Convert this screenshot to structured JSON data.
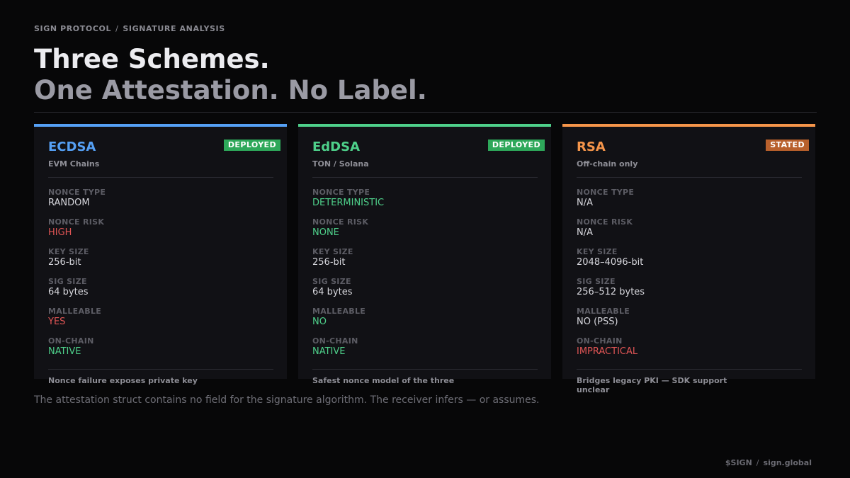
{
  "breadcrumb": {
    "part1": "SIGN PROTOCOL",
    "separator": "/",
    "part2": "SIGNATURE ANALYSIS"
  },
  "title": {
    "line1": "Three Schemes.",
    "line2": "One Attestation. No Label."
  },
  "cards": [
    {
      "name": "ECDSA",
      "badge": "DEPLOYED",
      "subtitle": "EVM Chains",
      "accent": "#55a0f5",
      "badge_color": "#2ea85a",
      "fields": [
        {
          "label": "NONCE TYPE",
          "value": "RANDOM",
          "status": "neutral"
        },
        {
          "label": "NONCE RISK",
          "value": "HIGH",
          "status": "bad"
        },
        {
          "label": "KEY SIZE",
          "value": "256-bit",
          "status": "neutral"
        },
        {
          "label": "SIG SIZE",
          "value": "64 bytes",
          "status": "neutral"
        },
        {
          "label": "MALLEABLE",
          "value": "YES",
          "status": "bad"
        },
        {
          "label": "ON-CHAIN",
          "value": "NATIVE",
          "status": "good"
        }
      ],
      "note": "Nonce failure exposes private key"
    },
    {
      "name": "EdDSA",
      "badge": "DEPLOYED",
      "subtitle": "TON / Solana",
      "accent": "#4ed08a",
      "badge_color": "#2ea85a",
      "fields": [
        {
          "label": "NONCE TYPE",
          "value": "DETERMINISTIC",
          "status": "good"
        },
        {
          "label": "NONCE RISK",
          "value": "NONE",
          "status": "good"
        },
        {
          "label": "KEY SIZE",
          "value": "256-bit",
          "status": "neutral"
        },
        {
          "label": "SIG SIZE",
          "value": "64 bytes",
          "status": "neutral"
        },
        {
          "label": "MALLEABLE",
          "value": "NO",
          "status": "good"
        },
        {
          "label": "ON-CHAIN",
          "value": "NATIVE",
          "status": "good"
        }
      ],
      "note": "Safest nonce model of the three"
    },
    {
      "name": "RSA",
      "badge": "STATED",
      "subtitle": "Off-chain only",
      "accent": "#f5954a",
      "badge_color": "#b8602c",
      "fields": [
        {
          "label": "NONCE TYPE",
          "value": "N/A",
          "status": "neutral"
        },
        {
          "label": "NONCE RISK",
          "value": "N/A",
          "status": "neutral"
        },
        {
          "label": "KEY SIZE",
          "value": "2048–4096-bit",
          "status": "neutral"
        },
        {
          "label": "SIG SIZE",
          "value": "256–512 bytes",
          "status": "neutral"
        },
        {
          "label": "MALLEABLE",
          "value": "NO (PSS)",
          "status": "neutral"
        },
        {
          "label": "ON-CHAIN",
          "value": "IMPRACTICAL",
          "status": "bad"
        }
      ],
      "note": "Bridges legacy PKI — SDK support unclear"
    }
  ],
  "footnote": "The attestation struct contains no field for the signature algorithm. The receiver infers — or assumes.",
  "footer": {
    "token": "$SIGN",
    "separator": "/",
    "site": "sign.global"
  }
}
